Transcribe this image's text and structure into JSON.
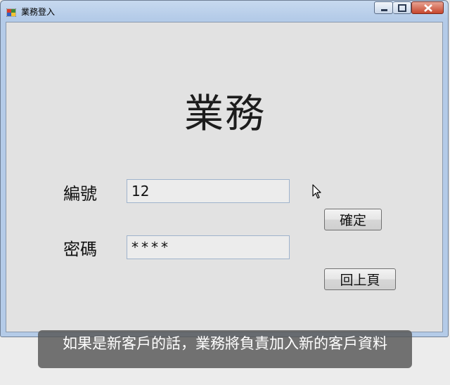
{
  "window": {
    "title": "業務登入",
    "controls": {
      "minimize": "minimize-icon",
      "maximize": "maximize-icon",
      "close": "close-icon"
    }
  },
  "form": {
    "heading": "業務",
    "id_label": "編號",
    "id_value": "12",
    "password_label": "密碼",
    "password_value": "****",
    "confirm_label": "確定",
    "back_label": "回上頁"
  },
  "caption": {
    "text": "如果是新客戶的話，業務將負責加入新的客戶資料"
  },
  "colors": {
    "title_bar": "#b4cbe8",
    "client_bg": "#e2e2e2",
    "close_button": "#c7462d"
  }
}
